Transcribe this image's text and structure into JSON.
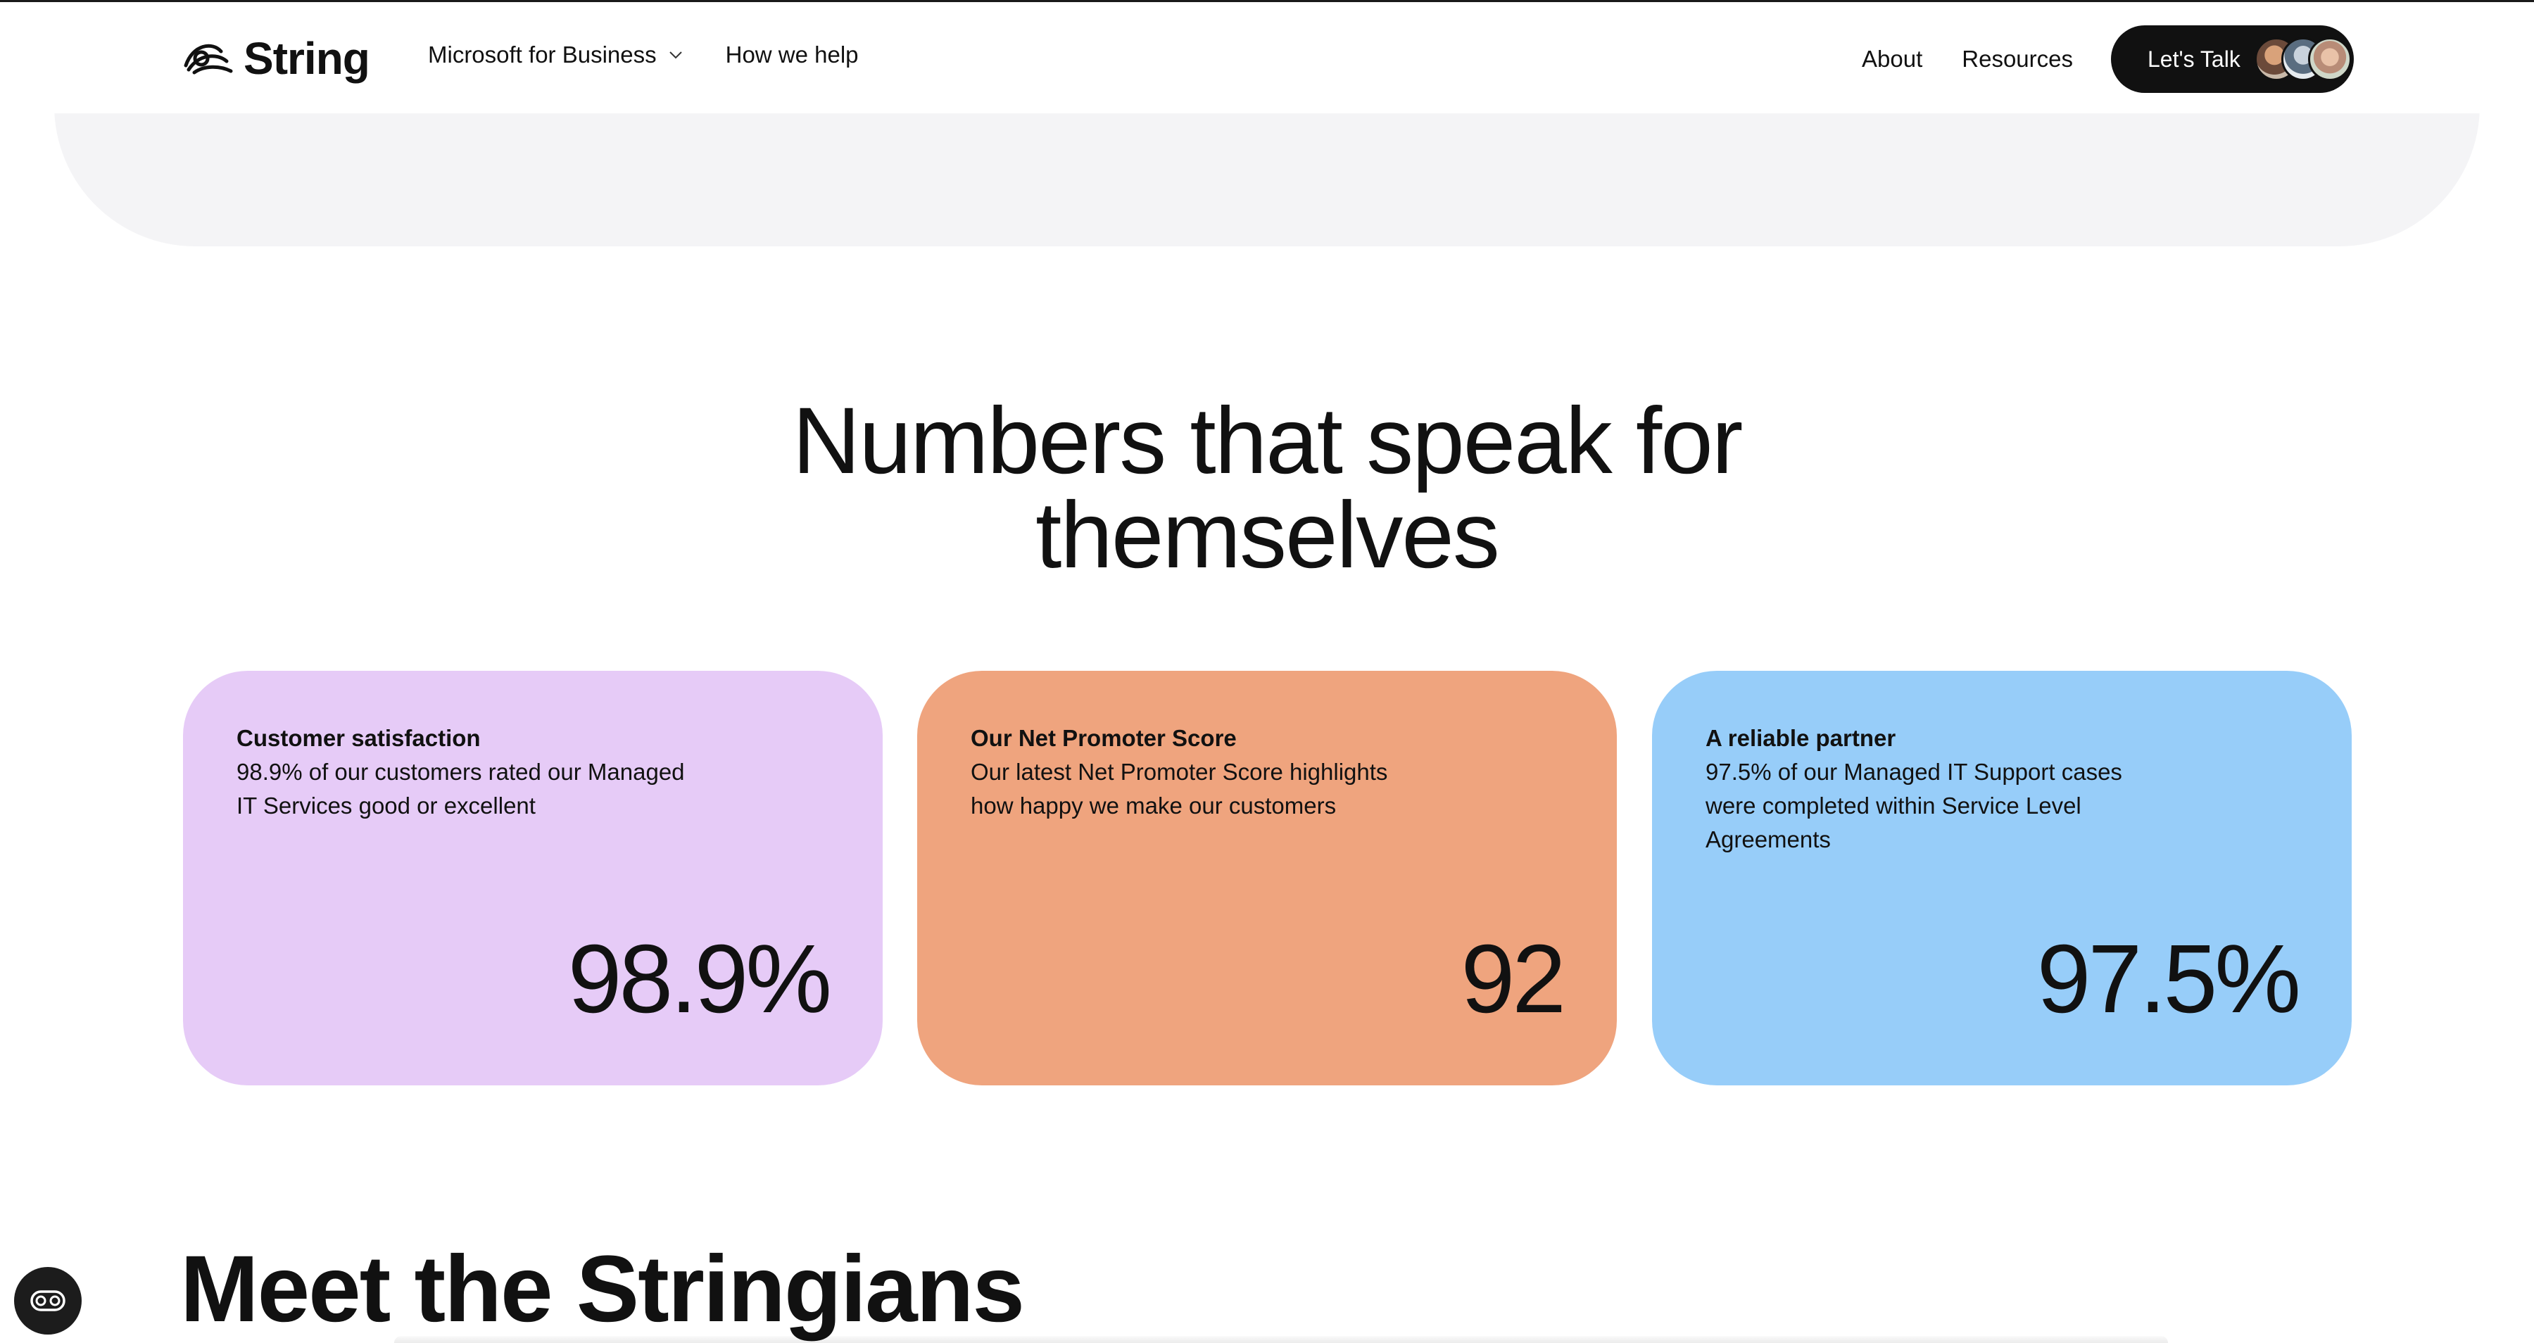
{
  "header": {
    "logo_text": "String",
    "nav_left": [
      {
        "label": "Microsoft for Business",
        "has_dropdown": true
      },
      {
        "label": "How we help"
      }
    ],
    "nav_right": [
      {
        "label": "About"
      },
      {
        "label": "Resources"
      }
    ],
    "cta_label": "Let's Talk"
  },
  "stats_section": {
    "title_line1": "Numbers that speak for",
    "title_line2": "themselves",
    "cards": [
      {
        "title": "Customer satisfaction",
        "description": "98.9% of our customers rated our Managed IT Services good or excellent",
        "value": "98.9%",
        "color": "#e6cbf7"
      },
      {
        "title": "Our Net Promoter Score",
        "description": "Our latest Net Promoter Score highlights how happy we make our customers",
        "value": "92",
        "color": "#efa47e"
      },
      {
        "title": "A reliable partner",
        "description": "97.5% of our Managed IT Support cases were completed within Service Level Agreements",
        "value": "97.5%",
        "color": "#97cdf9"
      }
    ]
  },
  "team_section": {
    "title": "Meet the Stringians"
  },
  "icons": {
    "consent": "cookie-consent-icon",
    "dropdown": "chevron-down-icon",
    "logo": "string-logo-icon"
  }
}
